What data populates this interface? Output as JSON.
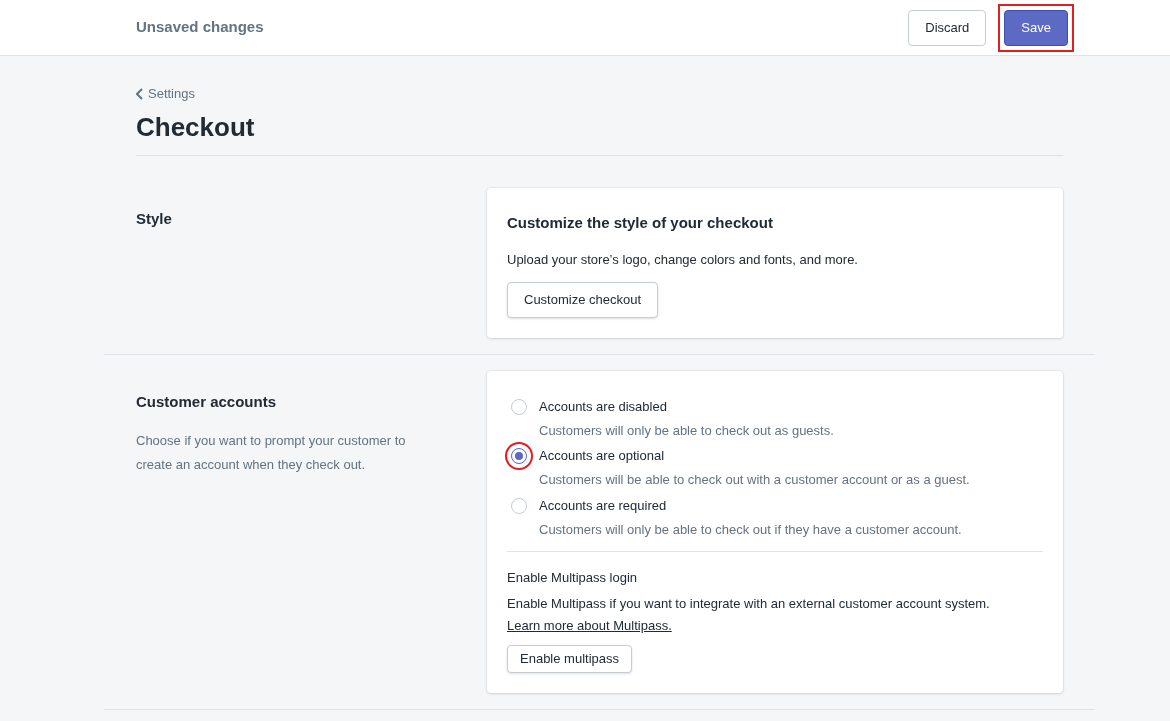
{
  "top_bar": {
    "title": "Unsaved changes",
    "buttons": [
      {
        "label": "Discard",
        "kind": "secondary",
        "highlighted": false
      },
      {
        "label": "Save",
        "kind": "primary",
        "highlighted": true
      }
    ]
  },
  "breadcrumb": "Settings",
  "page_title": "Checkout",
  "sections": [
    {
      "title": "Style",
      "card": {
        "heading": "Customize the style of your checkout",
        "text": "Upload your store’s logo, change colors and fonts, and more.",
        "button": "Customize checkout"
      }
    },
    {
      "title": "Customer accounts",
      "description": "Choose if you want to prompt your customer to create an account when they check out.",
      "options": [
        {
          "label": "Accounts are disabled",
          "help": "Customers will only be able to check out as guests.",
          "selected": false,
          "highlighted": false
        },
        {
          "label": "Accounts are optional",
          "help": "Customers will be able to check out with a customer account or as a guest.",
          "selected": true,
          "highlighted": true
        },
        {
          "label": "Accounts are required",
          "help": "Customers will only be able to check out if they have a customer account.",
          "selected": false,
          "highlighted": false
        }
      ],
      "multipass": {
        "heading": "Enable Multipass login",
        "text": "Enable Multipass if you want to integrate with an external customer account system.",
        "link": "Learn more about Multipass.",
        "button": "Enable multipass"
      }
    }
  ]
}
